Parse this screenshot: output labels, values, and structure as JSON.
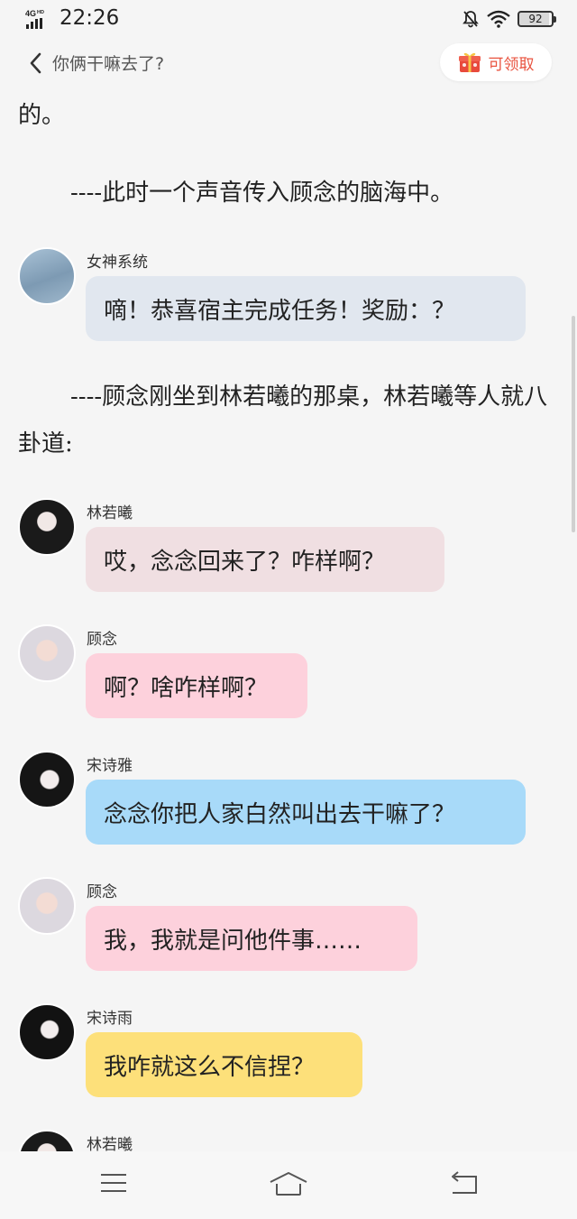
{
  "status": {
    "network": "4G HD",
    "time": "22:26",
    "battery": "92"
  },
  "nav": {
    "title": "你俩干嘛去了?",
    "reward_label": "可领取"
  },
  "story": {
    "narration_1": "的。",
    "narration_2": "----此时一个声音传入顾念的脑海中。",
    "narration_3": "----顾念刚坐到林若曦的那桌，林若曦等人就八卦道:",
    "messages": [
      {
        "speaker": "女神系统",
        "text": "嘀！恭喜宿主完成任务！奖励：？",
        "color": "#e1e7ef"
      },
      {
        "speaker": "林若曦",
        "text": "哎，念念回来了？咋样啊？",
        "color": "#f0dfe2"
      },
      {
        "speaker": "顾念",
        "text": "啊？啥咋样啊？",
        "color": "#fdd1dc"
      },
      {
        "speaker": "宋诗雅",
        "text": "念念你把人家白然叫出去干嘛了？",
        "color": "#a8daf9"
      },
      {
        "speaker": "顾念",
        "text": "我，我就是问他件事……",
        "color": "#fdd1dc"
      },
      {
        "speaker": "宋诗雨",
        "text": "我咋就这么不信捏？",
        "color": "#fde07a"
      },
      {
        "speaker": "林若曦",
        "text": "",
        "color": "#f0dfe2"
      }
    ]
  }
}
